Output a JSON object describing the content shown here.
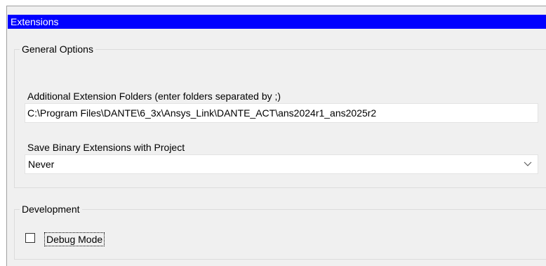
{
  "panel": {
    "title": "Extensions"
  },
  "general_options": {
    "legend": "General Options",
    "folders_label": "Additional Extension Folders (enter folders separated by ;)",
    "folders_value": "C:\\Program Files\\DANTE\\6_3x\\Ansys_Link\\DANTE_ACT\\ans2024r1_ans2025r2",
    "binary_label": "Save Binary Extensions with Project",
    "binary_value": "Never",
    "binary_icon": "chevron-down-icon"
  },
  "development": {
    "legend": "Development",
    "debug_label": "Debug Mode",
    "debug_checked": false
  },
  "colors": {
    "title_bar_bg": "#0000ff",
    "title_bar_text": "#ffffff",
    "panel_bg": "#f0f0f0"
  }
}
